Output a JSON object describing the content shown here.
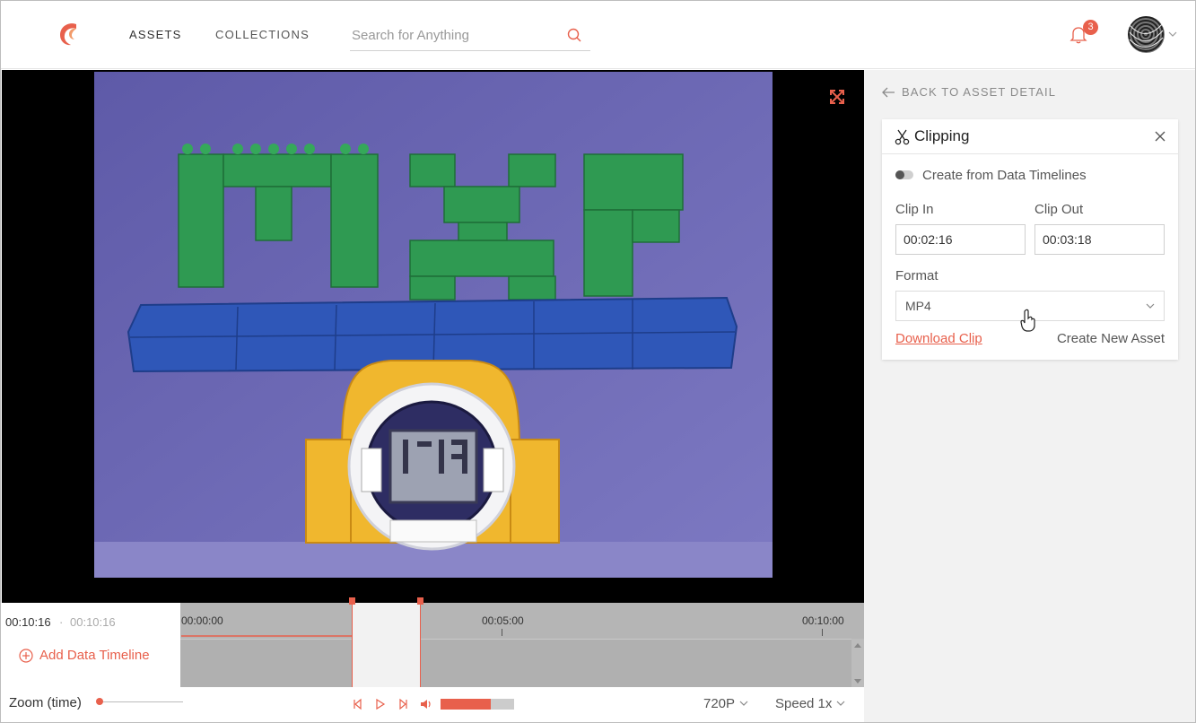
{
  "header": {
    "nav": {
      "assets": "ASSETS",
      "collections": "COLLECTIONS"
    },
    "search": {
      "placeholder": "Search for Anything"
    },
    "notifications": {
      "count": "3"
    }
  },
  "player": {
    "current_time": "00:10:16",
    "separator": "·",
    "duration": "00:10:16",
    "add_timeline_label": "Add Data Timeline",
    "ruler_labels": [
      "00:00:00",
      "00:05:00",
      "00:10:00"
    ],
    "zoom_label": "Zoom (time)",
    "volume_fraction": 0.68,
    "quality": "720P",
    "speed": "Speed 1x"
  },
  "panel": {
    "back_label": "BACK TO ASSET DETAIL",
    "clipping": {
      "title": "Clipping",
      "toggle_label": "Create from Data Timelines",
      "clip_in_label": "Clip In",
      "clip_in_value": "00:02:16",
      "clip_out_label": "Clip Out",
      "clip_out_value": "00:03:18",
      "format_label": "Format",
      "format_value": "MP4",
      "download_label": "Download Clip",
      "create_label": "Create New Asset"
    }
  },
  "colors": {
    "accent": "#e8604c",
    "panel_bg": "#f2f2f2",
    "timeline_bg": "#b5b5b5"
  }
}
